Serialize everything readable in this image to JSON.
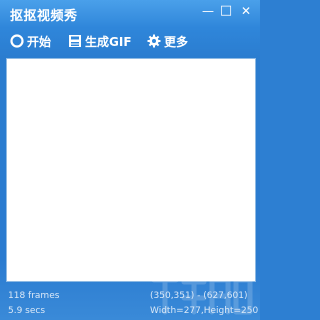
{
  "window": {
    "title": "抠抠视频秀",
    "minimize_glyph": "—",
    "restore_glyph": "□",
    "close_glyph": "✕"
  },
  "toolbar": {
    "start_label": "开始",
    "start_icon": "record-circle-icon",
    "gif_label": "生成GIF",
    "gif_icon": "save-disk-icon",
    "more_label": "更多",
    "more_icon": "gear-icon"
  },
  "status": {
    "frames": "118 frames",
    "duration": "5.9 secs",
    "coordinates": "(350,351) - (627,601)",
    "size": "Width=277,Height=250"
  }
}
